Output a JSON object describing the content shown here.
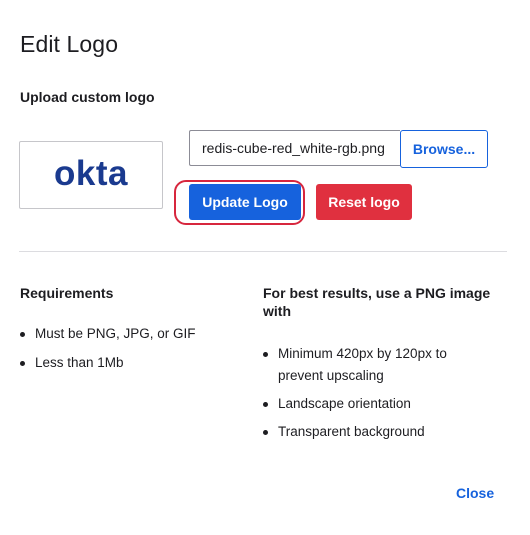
{
  "dialog": {
    "title": "Edit Logo",
    "subtitle": "Upload custom logo",
    "close_label": "Close"
  },
  "logo": {
    "wordmark": "okta",
    "color": "#1a3a8f"
  },
  "upload": {
    "file_value": "redis-cube-red_white-rgb.png",
    "browse_label": "Browse...",
    "update_label": "Update Logo",
    "reset_label": "Reset logo"
  },
  "requirements": {
    "heading": "Requirements",
    "items": [
      "Must be PNG, JPG, or GIF",
      "Less than 1Mb"
    ]
  },
  "best_results": {
    "heading": "For best results, use a PNG image with",
    "items": [
      "Minimum 420px by 120px to prevent upscaling",
      "Landscape orientation",
      "Transparent background"
    ]
  },
  "colors": {
    "primary": "#1662dd",
    "danger": "#e0303f",
    "highlight": "#d7263d"
  }
}
